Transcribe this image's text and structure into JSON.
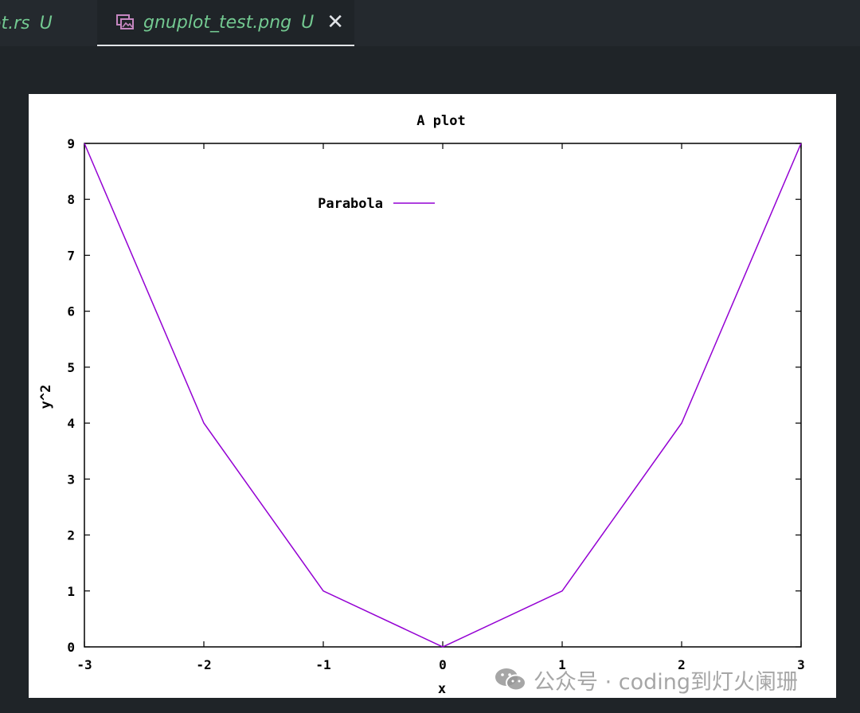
{
  "tabs": [
    {
      "label": "ot.rs",
      "status": "U"
    },
    {
      "label": "gnuplot_test.png",
      "status": "U",
      "close": "✕"
    }
  ],
  "watermark": {
    "text": "公众号 · coding到灯火阑珊"
  },
  "colors": {
    "line": "#9400d3",
    "tab_text": "#73c991",
    "background": "#1f2428"
  },
  "chart_data": {
    "type": "line",
    "title": "A plot",
    "xlabel": "x",
    "ylabel": "y^2",
    "xlim": [
      -3,
      3
    ],
    "ylim": [
      0,
      9
    ],
    "xticks": [
      "-3",
      "-2",
      "-1",
      "0",
      "1",
      "2",
      "3"
    ],
    "yticks": [
      "0",
      "1",
      "2",
      "3",
      "4",
      "5",
      "6",
      "7",
      "8",
      "9"
    ],
    "legend_position": "top-left",
    "grid": false,
    "series": [
      {
        "name": "Parabola",
        "x": [
          -3,
          -2,
          -1,
          0,
          1,
          2,
          3
        ],
        "y": [
          9,
          4,
          1,
          0,
          1,
          4,
          9
        ],
        "color": "#9400d3"
      }
    ]
  }
}
